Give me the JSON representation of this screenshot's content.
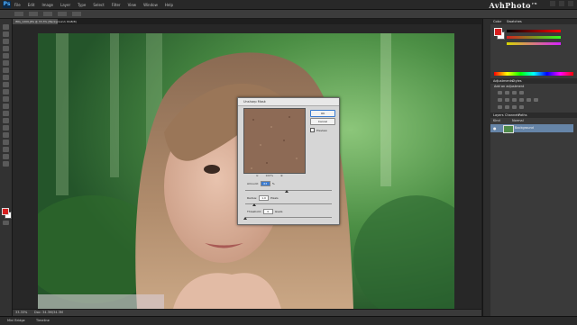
{
  "app": {
    "menu_items": [
      "File",
      "Edit",
      "Image",
      "Layer",
      "Type",
      "Select",
      "Filter",
      "View",
      "Window",
      "Help"
    ],
    "brand": "AvhPhoto",
    "brand_suffix": "ru",
    "document_tab": "IMG_1209.JPG @ 33.3% (Background, RGB/8)",
    "status_zoom": "33.33%",
    "status_doc": "Doc: 34.3M/34.3M",
    "bottom_tabs": [
      "Mini Bridge",
      "Timeline"
    ]
  },
  "colors": {
    "foreground": "#d61f1f",
    "background": "#ffffff",
    "accent": "#3b7bd0"
  },
  "panels": {
    "color_tabs": [
      "Color",
      "Swatches"
    ],
    "adjust_tabs": [
      "Adjustments",
      "Styles"
    ],
    "adjust_title": "Add an adjustment",
    "layers_tabs": [
      "Layers",
      "Channels",
      "Paths"
    ],
    "layer_kind": "Kind",
    "layer_blend": "Normal",
    "layer_name": "Background"
  },
  "dialog": {
    "title": "Unsharp Mask",
    "ok": "OK",
    "cancel": "Cancel",
    "preview": "Preview",
    "zoom_level": "100%",
    "amount_label": "Amount:",
    "amount_value": "63",
    "amount_unit": "%",
    "radius_label": "Radius:",
    "radius_value": "1.0",
    "radius_unit": "Pixels",
    "threshold_label": "Threshold:",
    "threshold_value": "0",
    "threshold_unit": "levels"
  }
}
